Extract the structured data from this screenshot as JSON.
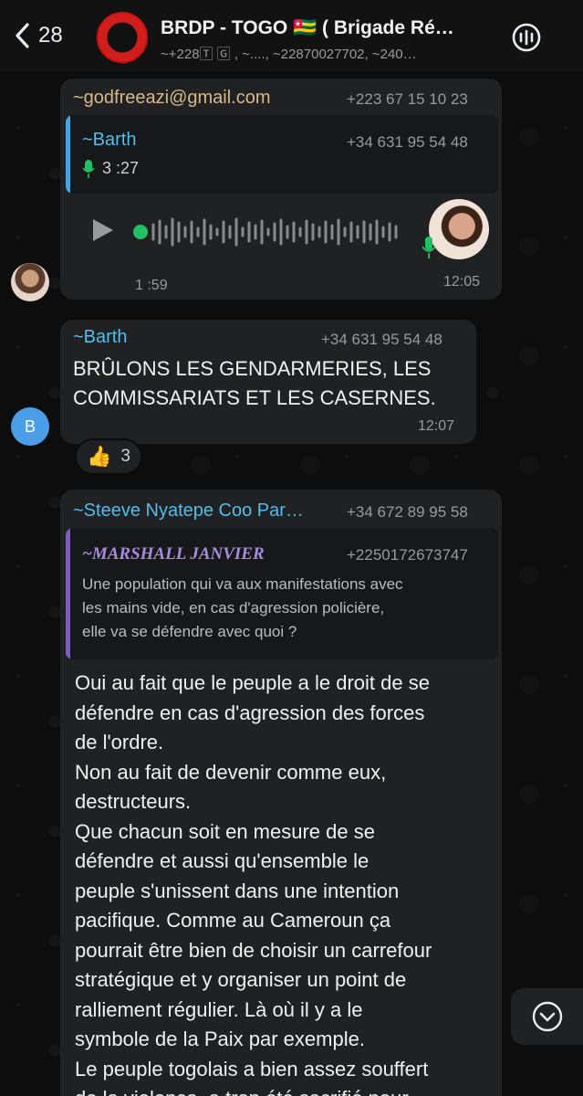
{
  "header": {
    "back_count": "28",
    "title": "BRDP - TOGO 🇹🇬 ( Brigade Ré…",
    "subtitle": "~+228🅃 🄶 , ~...., ~22870027702, ~240…"
  },
  "messages": {
    "voice": {
      "sender": "~godfreeazi@gmail.com",
      "phone": "+223 67 15 10 23",
      "quote_sender": "~Barth",
      "quote_phone": "+34 631 95 54 48",
      "quote_duration": "3 :27",
      "duration": "1 :59",
      "time": "12:05"
    },
    "barth": {
      "sender": "~Barth",
      "phone": "+34 631 95 54 48",
      "line1": "BRÛLONS LES GENDARMERIES, LES",
      "line2": "COMMISSARIATS ET LES CASERNES.",
      "time": "12:07",
      "avatar_letter": "B"
    },
    "reaction": {
      "emoji": "👍",
      "count": "3"
    },
    "steeve": {
      "sender": "~Steeve Nyatepe Coo Par…",
      "phone": "+34 672 89 95 58",
      "quote_sender": "~MARSHALL JANVIER",
      "quote_phone": "+2250172673747",
      "quote_lines": [
        "Une population qui va aux manifestations avec",
        "les mains vide, en cas d'agression policière,",
        "elle va se défendre avec quoi ?"
      ],
      "lines": [
        "Oui au fait que le peuple a le droit de se",
        "défendre en cas d'agression des forces",
        "de l'ordre.",
        "Non au fait de devenir comme eux,",
        "destructeurs.",
        "Que chacun soit en mesure de se",
        "défendre et aussi qu'ensemble le",
        "peuple s'unissent dans une intention",
        "pacifique. Comme au Cameroun ça",
        "pourrait être bien de choisir un carrefour",
        "stratégique et y organiser un point de",
        "ralliement régulier. Là où il y a le",
        "symbole de la Paix par exemple.",
        "Le peuple togolais a bien assez souffert",
        "de la violence, a trop été sacrifié pour"
      ]
    }
  },
  "colors": {
    "bubble": "#1f2123",
    "name_tan": "#d6b98c",
    "name_blue": "#53bdeb",
    "name_purple": "#a78be0",
    "green": "#21c063"
  }
}
